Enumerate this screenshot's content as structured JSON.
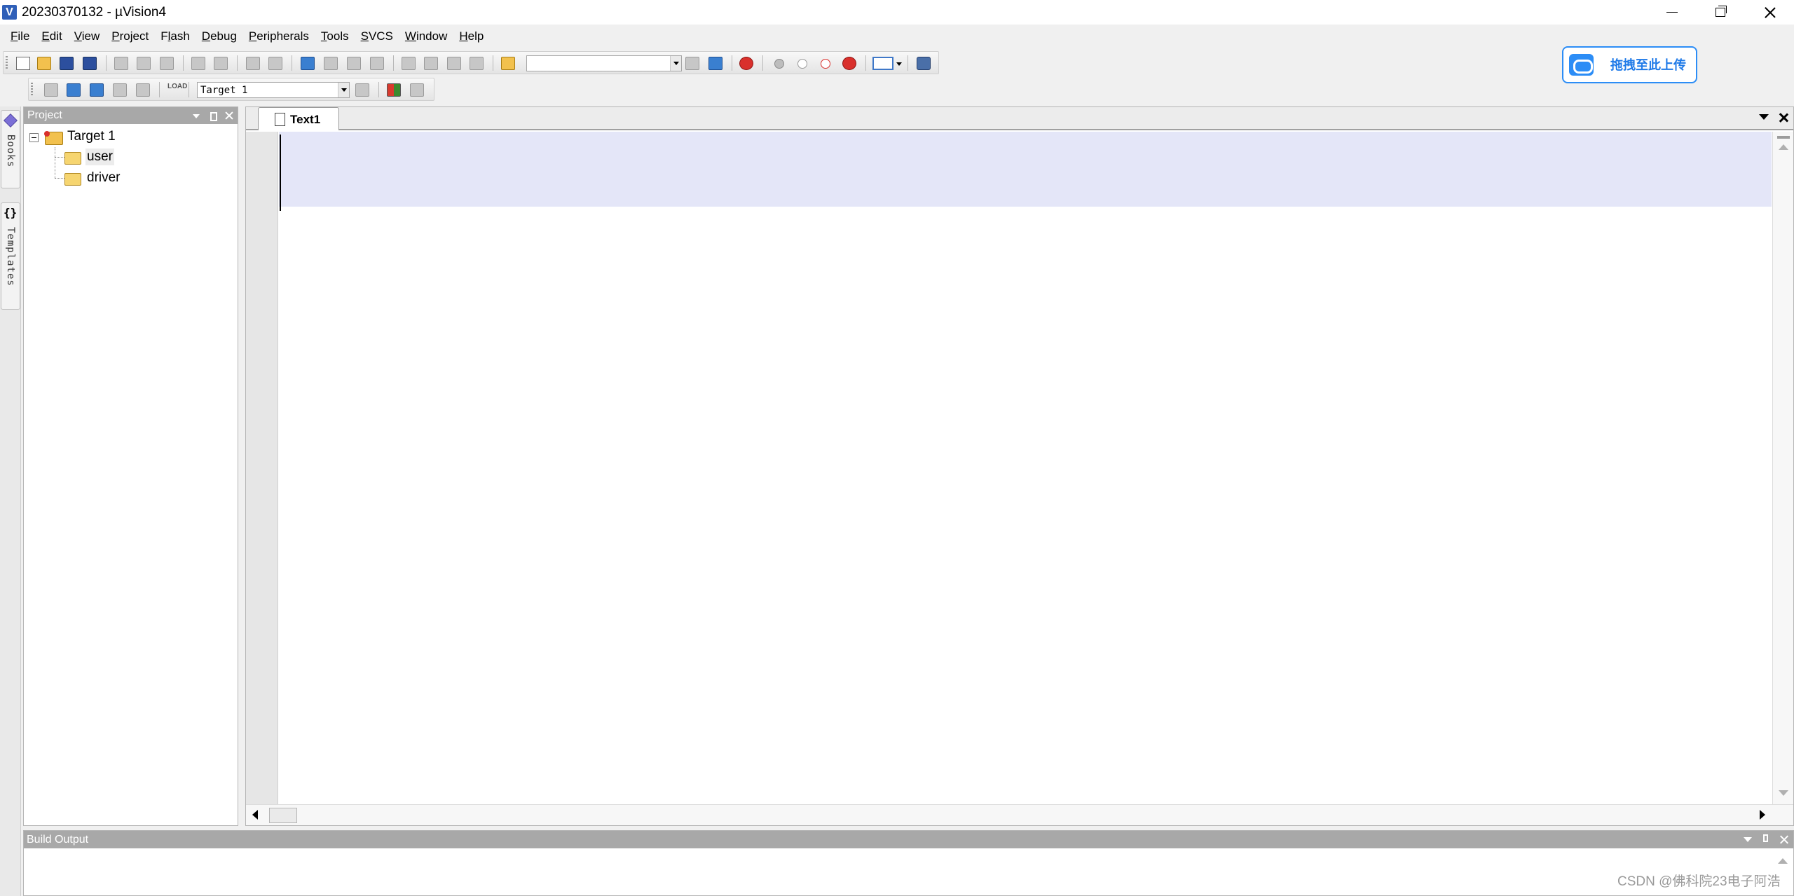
{
  "window": {
    "title": "20230370132  - µVision4",
    "app_icon": "V"
  },
  "menu": [
    {
      "label": "File",
      "mnemonic": "F",
      "rest": "ile"
    },
    {
      "label": "Edit",
      "mnemonic": "E",
      "rest": "dit"
    },
    {
      "label": "View",
      "mnemonic": "V",
      "rest": "iew"
    },
    {
      "label": "Project",
      "mnemonic": "P",
      "rest": "roject"
    },
    {
      "label": "Flash",
      "mnemonic": "l",
      "prefix": "F",
      "rest": "ash"
    },
    {
      "label": "Debug",
      "mnemonic": "D",
      "rest": "ebug"
    },
    {
      "label": "Peripherals",
      "mnemonic": "P",
      "rest": "eripherals"
    },
    {
      "label": "Tools",
      "mnemonic": "T",
      "rest": "ools"
    },
    {
      "label": "SVCS",
      "mnemonic": "S",
      "rest": "VCS"
    },
    {
      "label": "Window",
      "mnemonic": "W",
      "rest": "indow"
    },
    {
      "label": "Help",
      "mnemonic": "H",
      "rest": "elp"
    }
  ],
  "toolbar2": {
    "target_select": "Target 1",
    "load_label": "LOAD"
  },
  "upload": {
    "label": "拖拽至此上传",
    "accent": "#2c8df6"
  },
  "side_tabs": {
    "books": "Books",
    "templates": "Templates"
  },
  "project_panel": {
    "title": "Project",
    "tree": {
      "root": "Target 1",
      "groups": [
        "user",
        "driver"
      ]
    }
  },
  "editor": {
    "tab_label": "Text1",
    "current_line_color": "#e4e6f8"
  },
  "build_output": {
    "title": "Build Output"
  },
  "watermark": "CSDN @佛科院23电子阿浩"
}
